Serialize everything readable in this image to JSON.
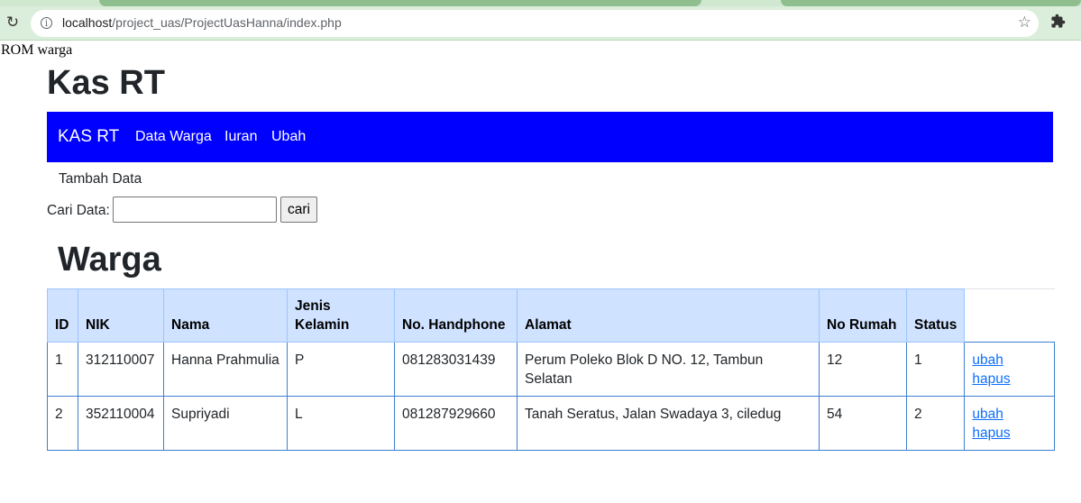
{
  "browser": {
    "url_host": "localhost",
    "url_path": "/project_uas/ProjectUasHanna/index.php"
  },
  "page": {
    "stray_text": "ROM warga",
    "title": "Kas RT",
    "navbar": {
      "brand": "KAS RT",
      "links": [
        "Data Warga",
        "Iuran",
        "Ubah"
      ]
    },
    "add_link": "Tambah Data",
    "search": {
      "label": "Cari Data:",
      "value": "",
      "button": "cari"
    },
    "section_title": "Warga",
    "table": {
      "headers": [
        "ID",
        "NIK",
        "Nama",
        "Jenis Kelamin",
        "No. Handphone",
        "Alamat",
        "No Rumah",
        "Status"
      ],
      "rows": [
        {
          "id": "1",
          "nik": "312110007",
          "nama": "Hanna Prahmulia",
          "jk": "P",
          "hp": "081283031439",
          "alamat": "Perum Poleko Blok D NO. 12, Tambun Selatan",
          "rumah": "12",
          "status": "1",
          "edit": "ubah",
          "delete": "hapus"
        },
        {
          "id": "2",
          "nik": "352110004",
          "nama": "Supriyadi",
          "jk": "L",
          "hp": "081287929660",
          "alamat": "Tanah Seratus, Jalan Swadaya 3, ciledug",
          "rumah": "54",
          "status": "2",
          "edit": "ubah",
          "delete": "hapus"
        }
      ]
    }
  },
  "colors": {
    "navbar": "#0000ff",
    "table_header": "#cfe2ff",
    "link": "#0d6efd"
  }
}
